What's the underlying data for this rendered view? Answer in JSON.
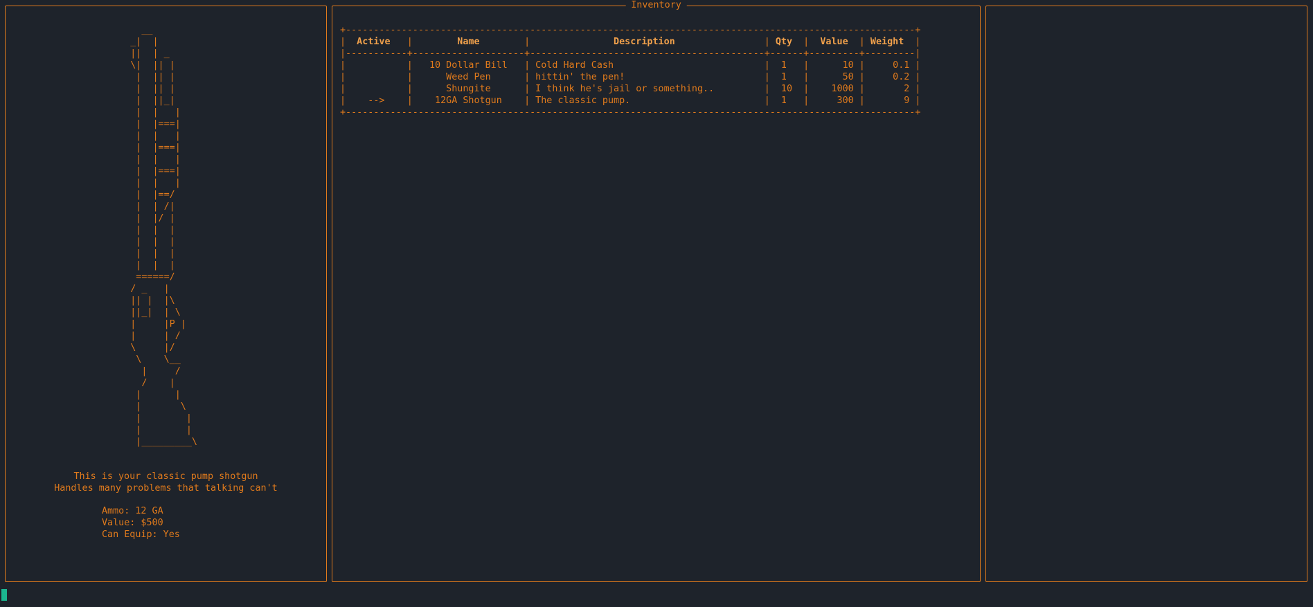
{
  "left_panel": {
    "ascii_art": "      __\n    _|  |\n    ||  | _\n    \\|  || |\n     |  || |\n     |  || |\n     |  ||_|\n     |  |   |\n     |  |===|\n     |  |   |\n     |  |===|\n     |  |   |\n     |  |===|\n     |  |   |\n     |  |==/\n     |  | /|\n     |  |/ |\n     |  |  |\n     |  |  |\n     |  |  |\n     |  |  |\n     ======/\n    / _   |\n    || |  |\\\n    ||_|  | \\\n    |     |P |\n    |     | /\n    \\     |/\n     \\    \\__\n      |     /\n      /    |\n     |      |\n     |       \\\n     |        |\n     |        |\n     |_________\\",
    "description_lines": [
      "This is your classic pump shotgun",
      "Handles many problems that talking can't"
    ],
    "stats": [
      "Ammo: 12 GA",
      "Value: $500",
      "Can Equip: Yes"
    ]
  },
  "center_panel": {
    "title": "Inventory",
    "columns": [
      "Active",
      "Name",
      "Description",
      "Qty",
      "Value",
      "Weight"
    ],
    "rows": [
      {
        "active": "",
        "name": "10 Dollar Bill",
        "description": "Cold Hard Cash",
        "qty": "1",
        "value": "10",
        "weight": "0.1"
      },
      {
        "active": "",
        "name": "Weed Pen",
        "description": "hittin' the pen!",
        "qty": "1",
        "value": "50",
        "weight": "0.2"
      },
      {
        "active": "",
        "name": "Shungite",
        "description": "I think he's jail or something..",
        "qty": "10",
        "value": "1000",
        "weight": "2"
      },
      {
        "active": "-->",
        "name": "12GA Shotgun",
        "description": "The classic pump.",
        "qty": "1",
        "value": "300",
        "weight": "9"
      }
    ]
  },
  "right_panel": {},
  "colors": {
    "background": "#1e232b",
    "accent": "#e07a1c",
    "header": "#f0a04b",
    "cursor": "#1bb58f"
  }
}
